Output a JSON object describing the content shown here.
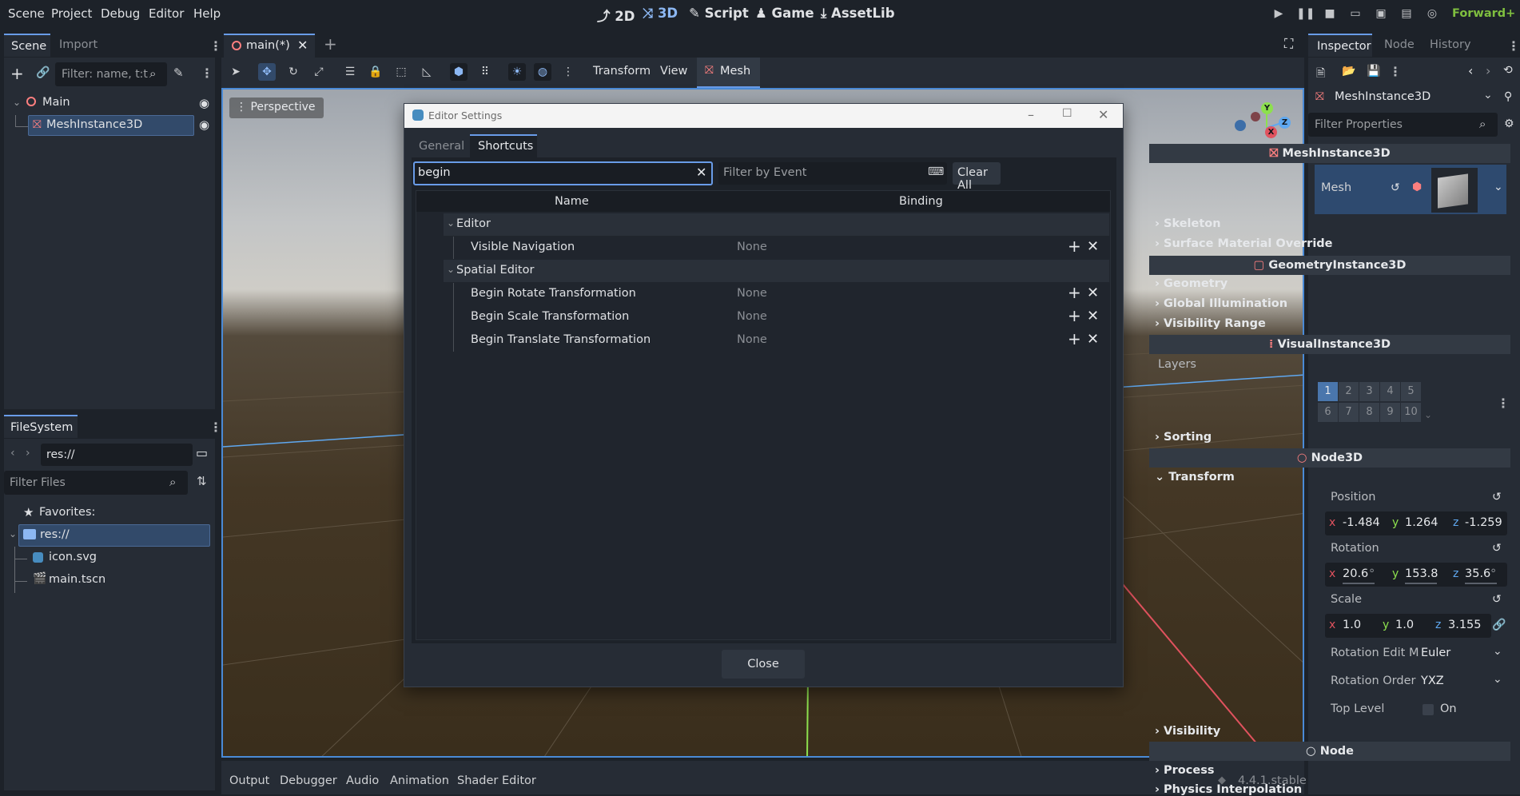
{
  "menu": {
    "items": [
      "Scene",
      "Project",
      "Debug",
      "Editor",
      "Help"
    ]
  },
  "modes": {
    "2d": "2D",
    "3d": "3D",
    "script": "Script",
    "game": "Game",
    "assetlib": "AssetLib"
  },
  "renderer": "Forward+",
  "scene_dock": {
    "tabs": {
      "scene": "Scene",
      "import": "Import"
    },
    "filter_placeholder": "Filter: name, t:t",
    "tree": [
      {
        "label": "Main"
      },
      {
        "label": "MeshInstance3D"
      }
    ]
  },
  "filesystem": {
    "tab": "FileSystem",
    "path": "res://",
    "filter_placeholder": "Filter Files",
    "items": {
      "favorites": "Favorites:",
      "res": "res://",
      "icon": "icon.svg",
      "main": "main.tscn"
    }
  },
  "viewport": {
    "tab_label": "main(*)",
    "toolbar": {
      "transform": "Transform",
      "view": "View",
      "mesh": "Mesh"
    },
    "perspective": "Perspective",
    "gizmo": {
      "y": "Y",
      "x": "X",
      "z": "Z"
    }
  },
  "dialog": {
    "title": "Editor Settings",
    "tabs": {
      "general": "General",
      "shortcuts": "Shortcuts"
    },
    "search_value": "begin",
    "filter_event_placeholder": "Filter by Event",
    "clear_all": "Clear All",
    "columns": {
      "name": "Name",
      "binding": "Binding"
    },
    "groups": [
      {
        "name": "Editor",
        "rows": [
          {
            "name": "Visible Navigation",
            "binding": "None"
          }
        ]
      },
      {
        "name": "Spatial Editor",
        "rows": [
          {
            "name": "Begin Rotate Transformation",
            "binding": "None"
          },
          {
            "name": "Begin Scale Transformation",
            "binding": "None"
          },
          {
            "name": "Begin Translate Transformation",
            "binding": "None"
          }
        ]
      }
    ],
    "close": "Close"
  },
  "inspector": {
    "tabs": {
      "inspector": "Inspector",
      "node": "Node",
      "history": "History"
    },
    "node_type": "MeshInstance3D",
    "filter_placeholder": "Filter Properties",
    "sections": {
      "meshinstance": "MeshInstance3D",
      "mesh_label": "Mesh",
      "skeleton": "Skeleton",
      "surface": "Surface Material Override",
      "geometryinstance": "GeometryInstance3D",
      "geometry": "Geometry",
      "gi": "Global Illumination",
      "visrange": "Visibility Range",
      "visualinstance": "VisualInstance3D",
      "layers": "Layers",
      "sorting": "Sorting",
      "node3d": "Node3D",
      "transform": "Transform",
      "visibility": "Visibility",
      "node": "Node",
      "process": "Process",
      "physics_interp": "Physics Interpolation"
    },
    "layers": [
      "1",
      "2",
      "3",
      "4",
      "5",
      "6",
      "7",
      "8",
      "9",
      "10"
    ],
    "position": {
      "label": "Position",
      "x": "-1.484",
      "y": "1.264",
      "z": "-1.259"
    },
    "rotation": {
      "label": "Rotation",
      "x": "20.6",
      "y": "153.8",
      "z": "35.6",
      "unit": "°"
    },
    "scale": {
      "label": "Scale",
      "x": "1.0",
      "y": "1.0",
      "z": "3.155"
    },
    "rotation_edit": {
      "label": "Rotation Edit M",
      "value": "Euler"
    },
    "rotation_order": {
      "label": "Rotation Order",
      "value": "YXZ"
    },
    "top_level": {
      "label": "Top Level",
      "value": "On"
    },
    "axis_labels": {
      "x": "x",
      "y": "y",
      "z": "z"
    }
  },
  "bottom": {
    "tabs": [
      "Output",
      "Debugger",
      "Audio",
      "Animation",
      "Shader Editor"
    ],
    "version": "4.4.1.stable"
  },
  "colors": {
    "accent": "#699ce8",
    "x_axis": "#e0525e",
    "y_axis": "#8de04e",
    "z_axis": "#5fa8f0"
  }
}
